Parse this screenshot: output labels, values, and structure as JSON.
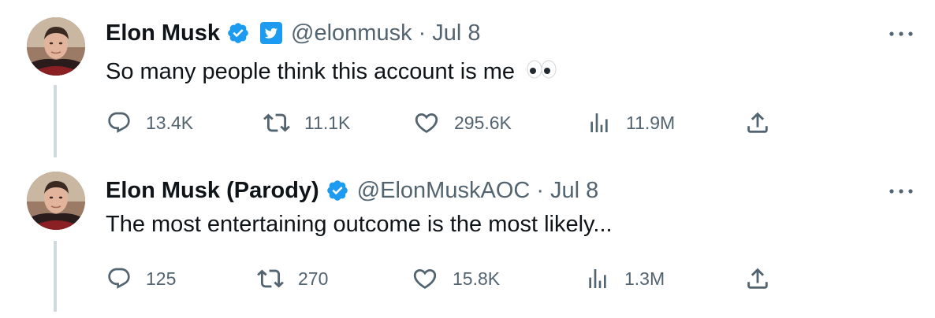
{
  "tweets": [
    {
      "name": "Elon Musk",
      "handle": "@elonmusk",
      "separator": "·",
      "date": "Jul 8",
      "text": "So many people think this account is me",
      "emoji": "👀",
      "replies": "13.4K",
      "retweets": "11.1K",
      "likes": "295.6K",
      "views": "11.9M"
    },
    {
      "name": "Elon Musk (Parody)",
      "handle": "@ElonMuskAOC",
      "separator": "·",
      "date": "Jul 8",
      "text": "The most entertaining outcome is the most likely...",
      "replies": "125",
      "retweets": "270",
      "likes": "15.8K",
      "views": "1.3M"
    }
  ],
  "colors": {
    "verified_blue": "#1d9bf0",
    "muted_text": "#536471",
    "thread_line": "#cfd9de"
  },
  "icons": [
    "reply-icon",
    "retweet-icon",
    "like-icon",
    "views-icon",
    "share-icon",
    "more-icon",
    "verified-badge-icon",
    "twitter-logo-icon"
  ]
}
